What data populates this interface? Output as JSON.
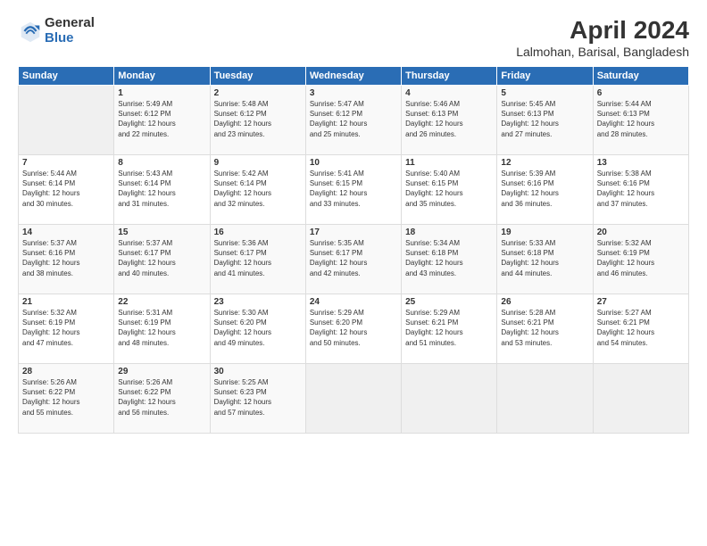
{
  "logo": {
    "general": "General",
    "blue": "Blue"
  },
  "title": "April 2024",
  "location": "Lalmohan, Barisal, Bangladesh",
  "headers": [
    "Sunday",
    "Monday",
    "Tuesday",
    "Wednesday",
    "Thursday",
    "Friday",
    "Saturday"
  ],
  "weeks": [
    [
      {
        "num": "",
        "info": ""
      },
      {
        "num": "1",
        "info": "Sunrise: 5:49 AM\nSunset: 6:12 PM\nDaylight: 12 hours\nand 22 minutes."
      },
      {
        "num": "2",
        "info": "Sunrise: 5:48 AM\nSunset: 6:12 PM\nDaylight: 12 hours\nand 23 minutes."
      },
      {
        "num": "3",
        "info": "Sunrise: 5:47 AM\nSunset: 6:12 PM\nDaylight: 12 hours\nand 25 minutes."
      },
      {
        "num": "4",
        "info": "Sunrise: 5:46 AM\nSunset: 6:13 PM\nDaylight: 12 hours\nand 26 minutes."
      },
      {
        "num": "5",
        "info": "Sunrise: 5:45 AM\nSunset: 6:13 PM\nDaylight: 12 hours\nand 27 minutes."
      },
      {
        "num": "6",
        "info": "Sunrise: 5:44 AM\nSunset: 6:13 PM\nDaylight: 12 hours\nand 28 minutes."
      }
    ],
    [
      {
        "num": "7",
        "info": "Sunrise: 5:44 AM\nSunset: 6:14 PM\nDaylight: 12 hours\nand 30 minutes."
      },
      {
        "num": "8",
        "info": "Sunrise: 5:43 AM\nSunset: 6:14 PM\nDaylight: 12 hours\nand 31 minutes."
      },
      {
        "num": "9",
        "info": "Sunrise: 5:42 AM\nSunset: 6:14 PM\nDaylight: 12 hours\nand 32 minutes."
      },
      {
        "num": "10",
        "info": "Sunrise: 5:41 AM\nSunset: 6:15 PM\nDaylight: 12 hours\nand 33 minutes."
      },
      {
        "num": "11",
        "info": "Sunrise: 5:40 AM\nSunset: 6:15 PM\nDaylight: 12 hours\nand 35 minutes."
      },
      {
        "num": "12",
        "info": "Sunrise: 5:39 AM\nSunset: 6:16 PM\nDaylight: 12 hours\nand 36 minutes."
      },
      {
        "num": "13",
        "info": "Sunrise: 5:38 AM\nSunset: 6:16 PM\nDaylight: 12 hours\nand 37 minutes."
      }
    ],
    [
      {
        "num": "14",
        "info": "Sunrise: 5:37 AM\nSunset: 6:16 PM\nDaylight: 12 hours\nand 38 minutes."
      },
      {
        "num": "15",
        "info": "Sunrise: 5:37 AM\nSunset: 6:17 PM\nDaylight: 12 hours\nand 40 minutes."
      },
      {
        "num": "16",
        "info": "Sunrise: 5:36 AM\nSunset: 6:17 PM\nDaylight: 12 hours\nand 41 minutes."
      },
      {
        "num": "17",
        "info": "Sunrise: 5:35 AM\nSunset: 6:17 PM\nDaylight: 12 hours\nand 42 minutes."
      },
      {
        "num": "18",
        "info": "Sunrise: 5:34 AM\nSunset: 6:18 PM\nDaylight: 12 hours\nand 43 minutes."
      },
      {
        "num": "19",
        "info": "Sunrise: 5:33 AM\nSunset: 6:18 PM\nDaylight: 12 hours\nand 44 minutes."
      },
      {
        "num": "20",
        "info": "Sunrise: 5:32 AM\nSunset: 6:19 PM\nDaylight: 12 hours\nand 46 minutes."
      }
    ],
    [
      {
        "num": "21",
        "info": "Sunrise: 5:32 AM\nSunset: 6:19 PM\nDaylight: 12 hours\nand 47 minutes."
      },
      {
        "num": "22",
        "info": "Sunrise: 5:31 AM\nSunset: 6:19 PM\nDaylight: 12 hours\nand 48 minutes."
      },
      {
        "num": "23",
        "info": "Sunrise: 5:30 AM\nSunset: 6:20 PM\nDaylight: 12 hours\nand 49 minutes."
      },
      {
        "num": "24",
        "info": "Sunrise: 5:29 AM\nSunset: 6:20 PM\nDaylight: 12 hours\nand 50 minutes."
      },
      {
        "num": "25",
        "info": "Sunrise: 5:29 AM\nSunset: 6:21 PM\nDaylight: 12 hours\nand 51 minutes."
      },
      {
        "num": "26",
        "info": "Sunrise: 5:28 AM\nSunset: 6:21 PM\nDaylight: 12 hours\nand 53 minutes."
      },
      {
        "num": "27",
        "info": "Sunrise: 5:27 AM\nSunset: 6:21 PM\nDaylight: 12 hours\nand 54 minutes."
      }
    ],
    [
      {
        "num": "28",
        "info": "Sunrise: 5:26 AM\nSunset: 6:22 PM\nDaylight: 12 hours\nand 55 minutes."
      },
      {
        "num": "29",
        "info": "Sunrise: 5:26 AM\nSunset: 6:22 PM\nDaylight: 12 hours\nand 56 minutes."
      },
      {
        "num": "30",
        "info": "Sunrise: 5:25 AM\nSunset: 6:23 PM\nDaylight: 12 hours\nand 57 minutes."
      },
      {
        "num": "",
        "info": ""
      },
      {
        "num": "",
        "info": ""
      },
      {
        "num": "",
        "info": ""
      },
      {
        "num": "",
        "info": ""
      }
    ]
  ]
}
